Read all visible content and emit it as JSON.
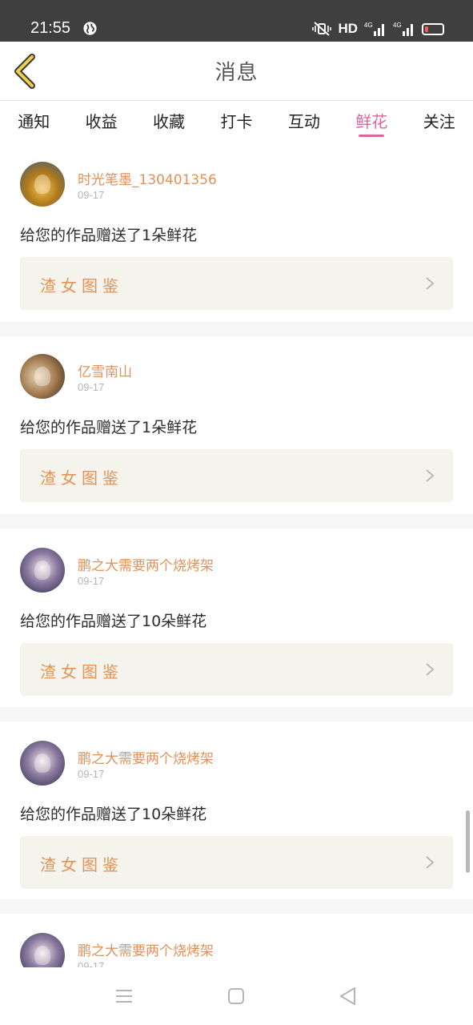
{
  "status_bar": {
    "time": "21:55",
    "network": "HD",
    "signal_1": "4G",
    "signal_2": "4G",
    "battery_color": "#ff5a5a"
  },
  "header": {
    "title": "消息",
    "back_icon": "chevron-left-icon"
  },
  "tabs": [
    {
      "label": "通知",
      "active": false
    },
    {
      "label": "收益",
      "active": false
    },
    {
      "label": "收藏",
      "active": false
    },
    {
      "label": "打卡",
      "active": false
    },
    {
      "label": "互动",
      "active": false
    },
    {
      "label": "鲜花",
      "active": true
    },
    {
      "label": "关注",
      "active": false
    }
  ],
  "accent_color": "#d9679e",
  "username_color": "#e3915a",
  "notifications": [
    {
      "user": "时光笔墨_130401356",
      "date": "09-17",
      "message": "给您的作品赠送了1朵鲜花",
      "work": "渣女图鉴"
    },
    {
      "user": "亿雪南山",
      "date": "09-17",
      "message": "给您的作品赠送了1朵鲜花",
      "work": "渣女图鉴"
    },
    {
      "user": "鹏之大需要两个烧烤架",
      "date": "09-17",
      "message": "给您的作品赠送了10朵鲜花",
      "work": "渣女图鉴"
    },
    {
      "user": "鹏之大需要两个烧烤架",
      "date": "09-17",
      "message": "给您的作品赠送了10朵鲜花",
      "work": "渣女图鉴"
    },
    {
      "user": "鹏之大需要两个烧烤架",
      "date": "09-17",
      "message": "",
      "work": ""
    }
  ],
  "nav_bar": {
    "icons": [
      "menu-icon",
      "home-square-icon",
      "back-triangle-icon"
    ]
  }
}
